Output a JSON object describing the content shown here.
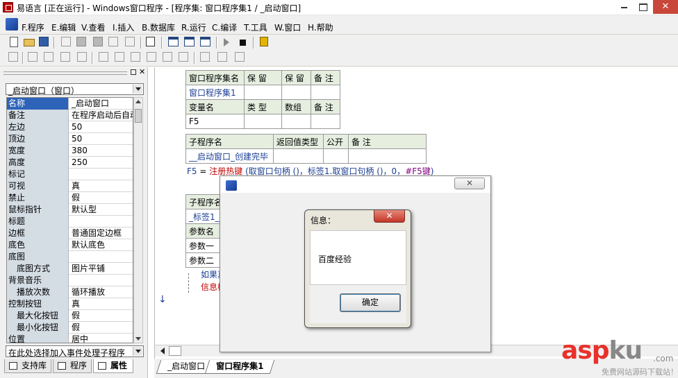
{
  "window": {
    "title": "易语言 [正在运行] - Windows窗口程序 - [程序集: 窗口程序集1 / _启动窗口]",
    "close_glyph": "✕"
  },
  "menu": [
    "F.程序",
    "E.编辑",
    "V.查看",
    "I.插入",
    "B.数据库",
    "R.运行",
    "C.编译",
    "T.工具",
    "W.窗口",
    "H.帮助"
  ],
  "panel": {
    "close_glyph": "✕",
    "object_selector": "_启动窗口（窗口）",
    "properties": [
      {
        "name": "名称",
        "value": "_启动窗口",
        "selected": true,
        "indent": false
      },
      {
        "name": "备注",
        "value": "在程序启动后自动",
        "selected": false,
        "indent": false
      },
      {
        "name": "左边",
        "value": "50",
        "selected": false,
        "indent": false
      },
      {
        "name": "顶边",
        "value": "50",
        "selected": false,
        "indent": false
      },
      {
        "name": "宽度",
        "value": "380",
        "selected": false,
        "indent": false
      },
      {
        "name": "高度",
        "value": "250",
        "selected": false,
        "indent": false
      },
      {
        "name": "标记",
        "value": "",
        "selected": false,
        "indent": false
      },
      {
        "name": "可视",
        "value": "真",
        "selected": false,
        "indent": false
      },
      {
        "name": "禁止",
        "value": "假",
        "selected": false,
        "indent": false
      },
      {
        "name": "鼠标指针",
        "value": "默认型",
        "selected": false,
        "indent": false
      },
      {
        "name": "标题",
        "value": "",
        "selected": false,
        "indent": false
      },
      {
        "name": "边框",
        "value": "普通固定边框",
        "selected": false,
        "indent": false
      },
      {
        "name": "底色",
        "value": "默认底色",
        "selected": false,
        "indent": false
      },
      {
        "name": "底图",
        "value": "",
        "selected": false,
        "indent": false
      },
      {
        "name": "底图方式",
        "value": "图片平铺",
        "selected": false,
        "indent": true
      },
      {
        "name": "背景音乐",
        "value": "",
        "selected": false,
        "indent": false
      },
      {
        "name": "播放次数",
        "value": "循环播放",
        "selected": false,
        "indent": true
      },
      {
        "name": "控制按钮",
        "value": "真",
        "selected": false,
        "indent": false
      },
      {
        "name": "最大化按钮",
        "value": "假",
        "selected": false,
        "indent": true
      },
      {
        "name": "最小化按钮",
        "value": "假",
        "selected": false,
        "indent": true
      },
      {
        "name": "位置",
        "value": "居中",
        "selected": false,
        "indent": false
      }
    ],
    "event_selector": "在此处选择加入事件处理子程序",
    "tabs": [
      "支持库",
      "程序",
      "属性"
    ]
  },
  "editor": {
    "assembly_table": {
      "rows": [
        [
          "窗口程序集名",
          "保 留",
          "保 留",
          "备 注"
        ],
        [
          "窗口程序集1",
          "",
          "",
          ""
        ],
        [
          "变量名",
          "类 型",
          "数组",
          "备 注"
        ],
        [
          "F5",
          "",
          "",
          ""
        ]
      ]
    },
    "sub_table": {
      "rows": [
        [
          "子程序名",
          "返回值类型",
          "公开",
          "备 注"
        ],
        [
          "__启动窗口_创建完毕",
          "",
          "",
          ""
        ]
      ]
    },
    "code_line": {
      "var": "F5",
      "op": " = ",
      "func": "注册热键",
      "args_a": " (取窗口句柄 ()，标签1.取窗口句柄 ()，0，",
      "key": "#F5键",
      "close": ")"
    },
    "sub2_rows": [
      "子程序名",
      "_标签1_",
      "参数名",
      "参数一",
      "参数二"
    ],
    "flow_lines": [
      "如果真",
      "信息框"
    ],
    "file_tabs": [
      "_启动窗口",
      "窗口程序集1"
    ]
  },
  "dialog_form": {
    "close_glyph": "✕"
  },
  "msgbox": {
    "title": "信息：",
    "close_glyph": "✕",
    "message": "百度经验",
    "ok_label": "确定"
  },
  "watermark": {
    "brand_a": "asp",
    "brand_b": "ku",
    "tld": ".com",
    "sub": "免费网站源码下载站！"
  }
}
